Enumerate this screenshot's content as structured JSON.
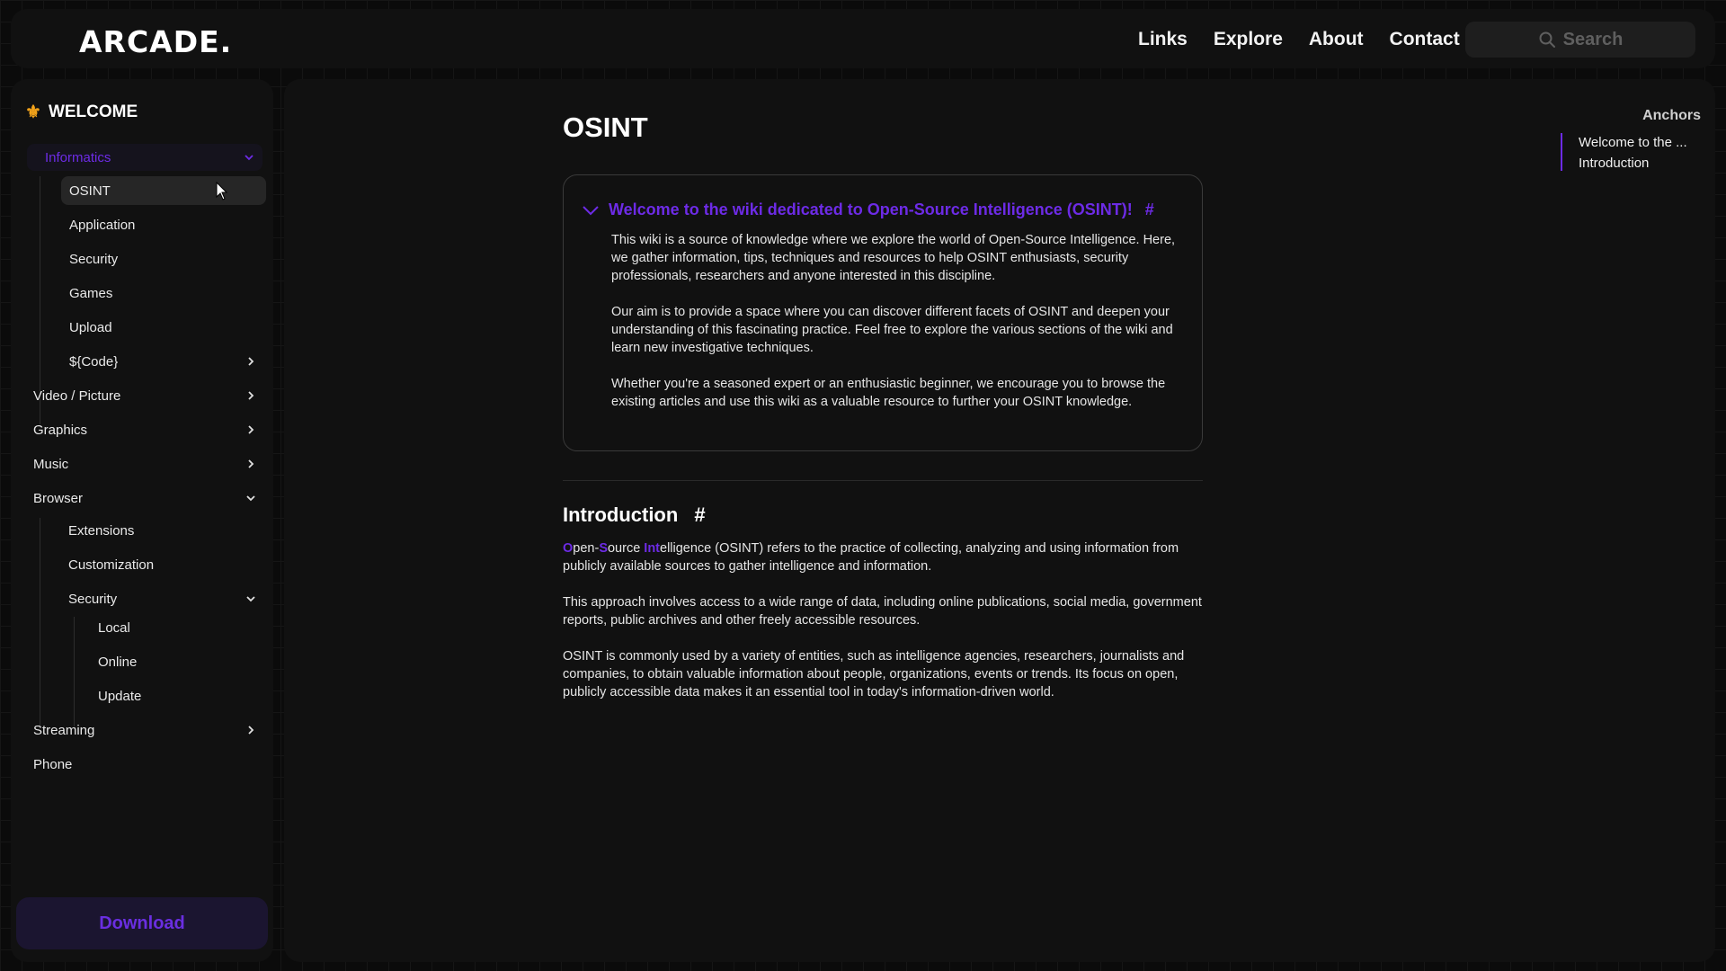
{
  "header": {
    "logo": "ARCADE.",
    "nav": [
      "Links",
      "Explore",
      "About",
      "Contact"
    ],
    "search_placeholder": "Search"
  },
  "sidebar": {
    "welcome": "WELCOME",
    "informatics": "Informatics",
    "informatics_items": [
      "OSINT",
      "Application",
      "Security",
      "Games",
      "Upload",
      "${Code}"
    ],
    "video_picture": "Video / Picture",
    "graphics": "Graphics",
    "music": "Music",
    "browser": "Browser",
    "browser_items": [
      "Extensions",
      "Customization",
      "Security"
    ],
    "browser_security_items": [
      "Local",
      "Online",
      "Update"
    ],
    "streaming": "Streaming",
    "phone": "Phone",
    "download": "Download",
    "selected_item": "OSINT"
  },
  "main": {
    "title": "OSINT",
    "card": {
      "heading": "Welcome to the wiki dedicated to Open-Source Intelligence (OSINT)!",
      "hash": "#",
      "paragraphs": [
        "This wiki is a source of knowledge where we explore the world of Open-Source Intelligence. Here, we gather information, tips, techniques and resources to help OSINT enthusiasts, security professionals, researchers and anyone interested in this discipline.",
        "Our aim is to provide a space where you can discover different facets of OSINT and deepen your understanding of this fascinating practice. Feel free to explore the various sections of the wiki and learn new investigative techniques.",
        "Whether you're a seasoned expert or an enthusiastic beginner, we encourage you to browse the existing articles and use this wiki as a valuable resource to further your OSINT knowledge."
      ]
    },
    "intro": {
      "title": "Introduction",
      "hash": "#",
      "p1_parts": [
        "O",
        "pen-",
        "S",
        "ource ",
        "Int",
        "elligence (OSINT) refers to the practice of collecting, analyzing and using information from publicly available sources to gather intelligence and information."
      ],
      "p2": "This approach involves access to a wide range of data, including online publications, social media, government reports, public archives and other freely accessible resources.",
      "p3": "OSINT is commonly used by a variety of entities, such as intelligence agencies, researchers, journalists and companies, to obtain valuable information about people, organizations, events or trends. Its focus on open, publicly accessible data makes it an essential tool in today's information-driven world."
    }
  },
  "anchors": {
    "title": "Anchors",
    "items": [
      "Welcome to the ...",
      "Introduction"
    ]
  },
  "colors": {
    "accent": "#6d2be6",
    "fleur": "#f2a21a",
    "panel": "#111111",
    "background": "#0b0b0b"
  },
  "icons": [
    "fleur-de-lis-icon",
    "search-icon",
    "chevron-down-icon",
    "chevron-right-icon",
    "mouse-cursor-icon"
  ]
}
